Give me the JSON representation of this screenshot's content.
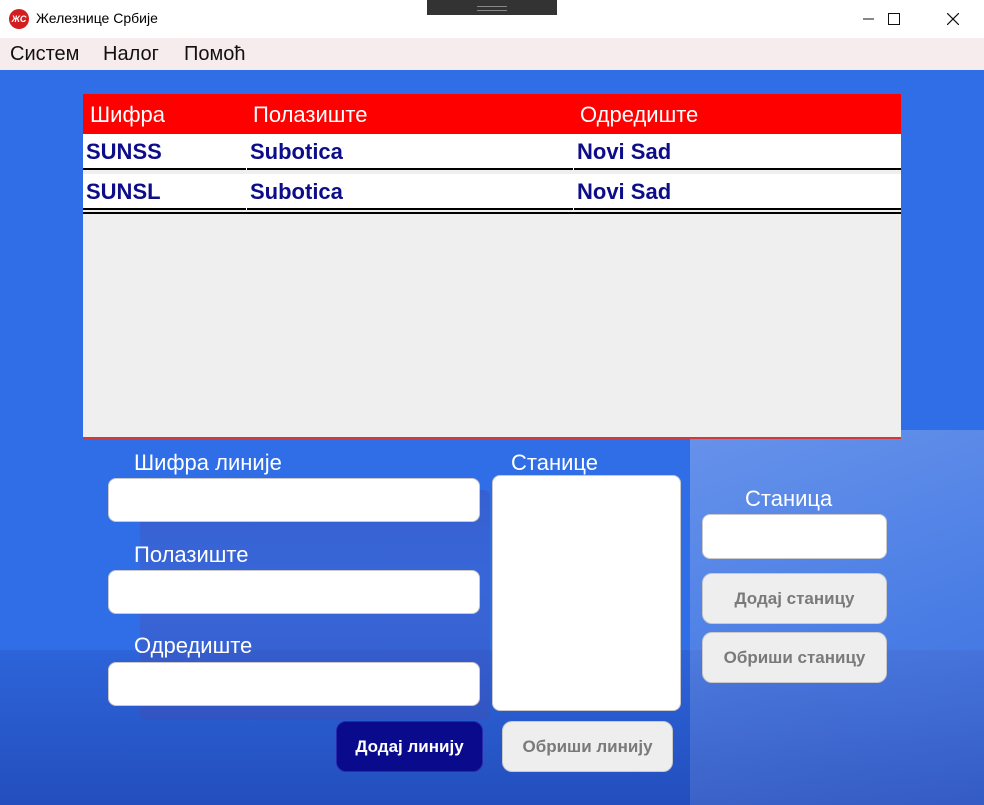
{
  "window": {
    "title": "Железнице Србије",
    "icon": "srbija-rail-logo-icon",
    "controls": [
      "minimize",
      "maximize",
      "close"
    ]
  },
  "menu": {
    "items": [
      "Систем",
      "Налог",
      "Помоћ"
    ]
  },
  "table": {
    "columns": [
      "Шифра",
      "Полазиште",
      "Одредиште"
    ],
    "rows": [
      [
        "SUNSS",
        "Subotica",
        "Novi Sad"
      ],
      [
        "SUNSL",
        "Subotica",
        "Novi Sad"
      ]
    ]
  },
  "form": {
    "code_label": "Шифра линије",
    "code_value": "",
    "origin_label": "Полазиште",
    "origin_value": "",
    "destination_label": "Одредиште",
    "destination_value": "",
    "stations_label": "Станице",
    "station_label": "Станица",
    "station_value": ""
  },
  "buttons": {
    "add_station": "Додај станицу",
    "delete_station": "Обриши станицу",
    "add_line": "Додај линију",
    "delete_line": "Обриши линију"
  },
  "colors": {
    "header_red": "#ff0000",
    "background_blue": "#2f6ee6",
    "primary_button": "#0a0a8c",
    "cell_text": "#0d0d8a"
  }
}
